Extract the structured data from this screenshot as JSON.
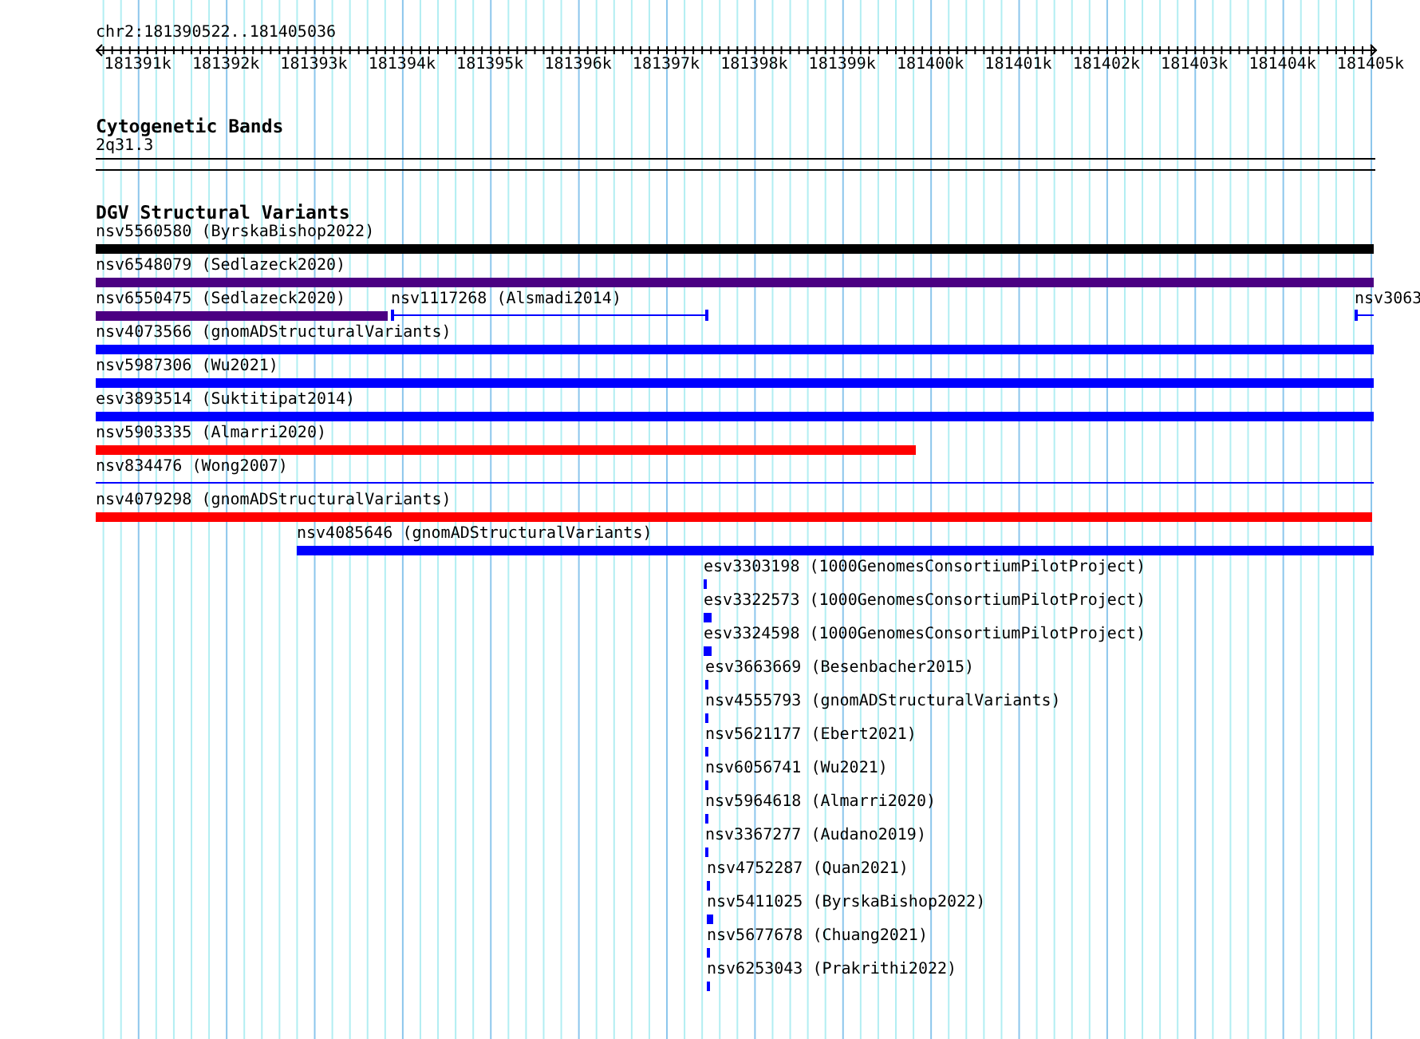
{
  "ruler": {
    "location": "chr2:181390522..181405036",
    "ticks": [
      {
        "label": "181391k"
      },
      {
        "label": "181392k"
      },
      {
        "label": "181393k"
      },
      {
        "label": "181394k"
      },
      {
        "label": "181395k"
      },
      {
        "label": "181396k"
      },
      {
        "label": "181397k"
      },
      {
        "label": "181398k"
      },
      {
        "label": "181399k"
      },
      {
        "label": "181400k"
      },
      {
        "label": "181401k"
      },
      {
        "label": "181402k"
      },
      {
        "label": "181403k"
      },
      {
        "label": "181404k"
      },
      {
        "label": "181405k"
      }
    ]
  },
  "tracks": [
    {
      "title": "Cytogenetic Bands",
      "kind": "bands",
      "bands": [
        {
          "label": "2q31.3"
        }
      ]
    },
    {
      "title": "DGV Structural Variants",
      "kind": "variants",
      "rows": [
        {
          "features": [
            {
              "label": "nsv5560580 (ByrskaBishop2022)",
              "kind": "thick",
              "color": "#000000"
            }
          ]
        },
        {
          "features": [
            {
              "label": "nsv6548079 (Sedlazeck2020)",
              "kind": "thick",
              "color": "#4b0082"
            }
          ]
        },
        {
          "features": [
            {
              "label": "nsv6550475 (Sedlazeck2020)",
              "kind": "thick",
              "color": "#4b0082"
            },
            {
              "label": "nsv1117268 (Alsmadi2014)",
              "kind": "capped_line",
              "color": "#0000ff"
            },
            {
              "label": "nsv3063",
              "kind": "capped_line",
              "color": "#0000ff"
            }
          ]
        },
        {
          "features": [
            {
              "label": "nsv4073566 (gnomADStructuralVariants)",
              "kind": "thick",
              "color": "#0000ff"
            }
          ]
        },
        {
          "features": [
            {
              "label": "nsv5987306 (Wu2021)",
              "kind": "thick",
              "color": "#0000ff"
            }
          ]
        },
        {
          "features": [
            {
              "label": "esv3893514 (Suktitipat2014)",
              "kind": "thick",
              "color": "#0000ff"
            }
          ]
        },
        {
          "features": [
            {
              "label": "nsv5903335 (Almarri2020)",
              "kind": "thick",
              "color": "#ff0000"
            }
          ]
        },
        {
          "features": [
            {
              "label": "nsv834476 (Wong2007)",
              "kind": "line",
              "color": "#0000ff"
            }
          ]
        },
        {
          "features": [
            {
              "label": "nsv4079298 (gnomADStructuralVariants)",
              "kind": "thick",
              "color": "#ff0000"
            }
          ]
        },
        {
          "features": [
            {
              "label": "nsv4085646 (gnomADStructuralVariants)",
              "kind": "thick",
              "color": "#0000ff"
            }
          ]
        },
        {
          "features": [
            {
              "label": "esv3303198 (1000GenomesConsortiumPilotProject)",
              "kind": "thick",
              "color": "#0000ff"
            }
          ]
        },
        {
          "features": [
            {
              "label": "esv3322573 (1000GenomesConsortiumPilotProject)",
              "kind": "thick",
              "color": "#0000ff"
            }
          ]
        },
        {
          "features": [
            {
              "label": "esv3324598 (1000GenomesConsortiumPilotProject)",
              "kind": "thick",
              "color": "#0000ff"
            }
          ]
        },
        {
          "features": [
            {
              "label": "esv3663669 (Besenbacher2015)",
              "kind": "thick",
              "color": "#0000ff"
            }
          ]
        },
        {
          "features": [
            {
              "label": "nsv4555793 (gnomADStructuralVariants)",
              "kind": "thick",
              "color": "#0000ff"
            }
          ]
        },
        {
          "features": [
            {
              "label": "nsv5621177 (Ebert2021)",
              "kind": "thick",
              "color": "#0000ff"
            }
          ]
        },
        {
          "features": [
            {
              "label": "nsv6056741 (Wu2021)",
              "kind": "thick",
              "color": "#0000ff"
            }
          ]
        },
        {
          "features": [
            {
              "label": "nsv5964618 (Almarri2020)",
              "kind": "thick",
              "color": "#0000ff"
            }
          ]
        },
        {
          "features": [
            {
              "label": "nsv3367277 (Audano2019)",
              "kind": "thick",
              "color": "#0000ff"
            }
          ]
        },
        {
          "features": [
            {
              "label": "nsv4752287 (Quan2021)",
              "kind": "thick",
              "color": "#0000ff"
            }
          ]
        },
        {
          "features": [
            {
              "label": "nsv5411025 (ByrskaBishop2022)",
              "kind": "thick",
              "color": "#0000ff"
            }
          ]
        },
        {
          "features": [
            {
              "label": "nsv5677678 (Chuang2021)",
              "kind": "thick",
              "color": "#0000ff"
            }
          ]
        },
        {
          "features": [
            {
              "label": "nsv6253043 (Prakrithi2022)",
              "kind": "thick",
              "color": "#0000ff"
            }
          ]
        }
      ]
    }
  ]
}
